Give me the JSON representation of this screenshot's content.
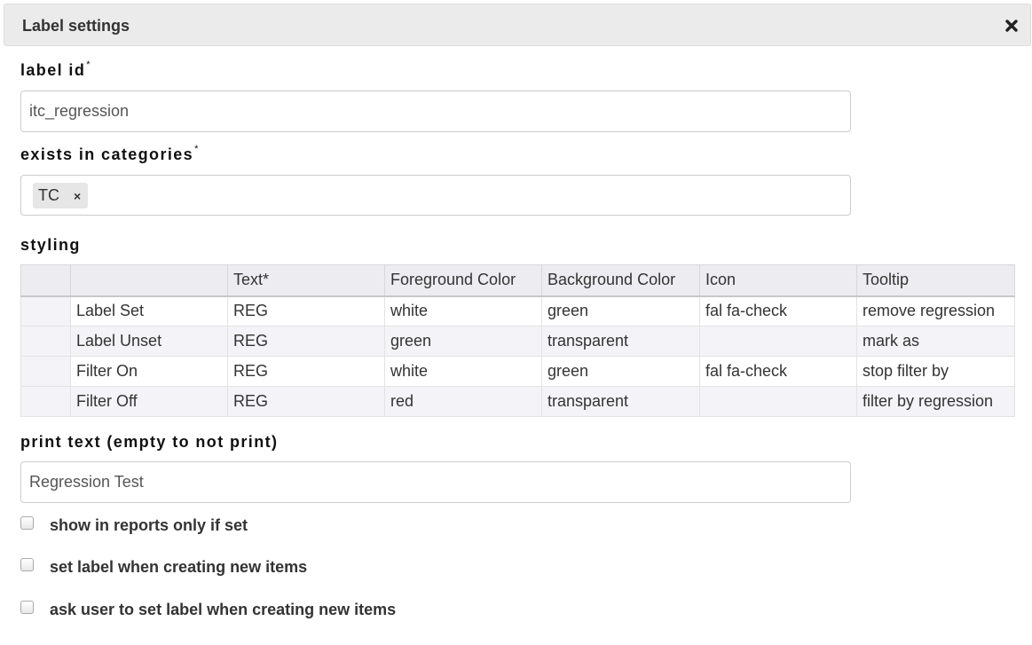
{
  "dialog": {
    "title": "Label settings",
    "close_icon": "close-x-icon"
  },
  "fields": {
    "label_id": {
      "label": "label id",
      "required_mark": "*",
      "value": "itc_regression"
    },
    "categories": {
      "label": "exists in categories",
      "required_mark": "*",
      "tags": [
        {
          "text": "TC",
          "remove": "×"
        }
      ]
    },
    "styling": {
      "label": "styling"
    },
    "print_text": {
      "label": "print text (empty to not print)",
      "value": "Regression Test"
    }
  },
  "table": {
    "headers": [
      "",
      "",
      "Text*",
      "Foreground Color",
      "Background Color",
      "Icon",
      "Tooltip"
    ],
    "rows": [
      {
        "name": "Label Set",
        "text": "REG",
        "fg": "white",
        "bg": "green",
        "icon": "fal fa-check",
        "tooltip": "remove regression"
      },
      {
        "name": "Label Unset",
        "text": "REG",
        "fg": "green",
        "bg": "transparent",
        "icon": "",
        "tooltip": "mark as"
      },
      {
        "name": "Filter On",
        "text": "REG",
        "fg": "white",
        "bg": "green",
        "icon": "fal fa-check",
        "tooltip": "stop filter by"
      },
      {
        "name": "Filter Off",
        "text": "REG",
        "fg": "red",
        "bg": "transparent",
        "icon": "",
        "tooltip": "filter by regression"
      }
    ]
  },
  "checkboxes": [
    {
      "label": "show in reports only if set",
      "checked": false
    },
    {
      "label": "set label when creating new items",
      "checked": false
    },
    {
      "label": "ask user to set label when creating new items",
      "checked": false
    }
  ],
  "colors": {
    "header_bg": "#ebebeb",
    "table_header_bg": "#ededf1",
    "alt_row_bg": "#f4f4f8",
    "input_border": "#cccccc"
  }
}
